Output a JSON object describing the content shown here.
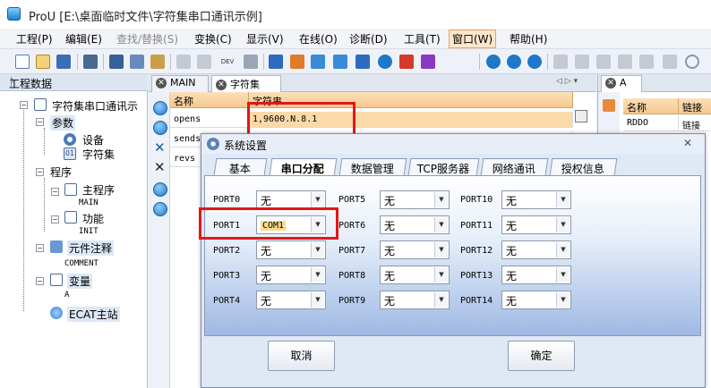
{
  "titlebar": {
    "title": "ProU [E:\\桌面临时文件\\字符集串口通讯示例]"
  },
  "menu": [
    "工程(P)",
    "编辑(E)",
    "查找/替换(S)",
    "变换(C)",
    "显示(V)",
    "在线(O)",
    "诊断(D)",
    "工具(T)",
    "窗口(W)",
    "帮助(H)"
  ],
  "toolbar": {
    "dev_label": "DEV"
  },
  "left_panel": {
    "header": "工程数据",
    "pin": "ᚹ",
    "root": "字符集串口通讯示",
    "params": "参数",
    "device": "设备",
    "charset": "字符集",
    "program": "程序",
    "main_program": "主程序",
    "main_sub": "MAIN",
    "function": "功能",
    "init_sub": "INIT",
    "comment": "元件注释",
    "comment_sub": "COMMENT",
    "variable": "变量",
    "var_sub": "A",
    "ecat": "ECAT主站"
  },
  "tabs": {
    "main": "MAIN",
    "charset": "字符集",
    "nav": "◁ ▷ ▾"
  },
  "grid": {
    "col_name": "名称",
    "col_string": "字符串",
    "rows": [
      {
        "name": "opens",
        "value": "1,9600.N.8.1"
      },
      {
        "name": "sends",
        "value": ""
      },
      {
        "name": "revs",
        "value": ""
      }
    ]
  },
  "right_panel": {
    "tab": "A",
    "col_name": "名称",
    "col_link": "链接",
    "row_name": "RDDO",
    "row_link": "链接"
  },
  "dialog": {
    "title": "系统设置",
    "close": "✕",
    "tabs": [
      "基本",
      "串口分配",
      "数据管理",
      "TCP服务器",
      "网络通讯",
      "授权信息"
    ],
    "ports": [
      {
        "label": "PORT0",
        "value": "无"
      },
      {
        "label": "PORT1",
        "value": "COM1"
      },
      {
        "label": "PORT2",
        "value": "无"
      },
      {
        "label": "PORT3",
        "value": "无"
      },
      {
        "label": "PORT4",
        "value": "无"
      },
      {
        "label": "PORT5",
        "value": "无"
      },
      {
        "label": "PORT6",
        "value": "无"
      },
      {
        "label": "PORT7",
        "value": "无"
      },
      {
        "label": "PORT8",
        "value": "无"
      },
      {
        "label": "PORT9",
        "value": "无"
      },
      {
        "label": "PORT10",
        "value": "无"
      },
      {
        "label": "PORT11",
        "value": "无"
      },
      {
        "label": "PORT12",
        "value": "无"
      },
      {
        "label": "PORT13",
        "value": "无"
      },
      {
        "label": "PORT14",
        "value": "无"
      }
    ],
    "cancel": "取消",
    "ok": "确定"
  },
  "colors": {
    "highlight": "#e01818",
    "header_orange": "#f6c88e",
    "active_menu": "#fde6c9"
  }
}
